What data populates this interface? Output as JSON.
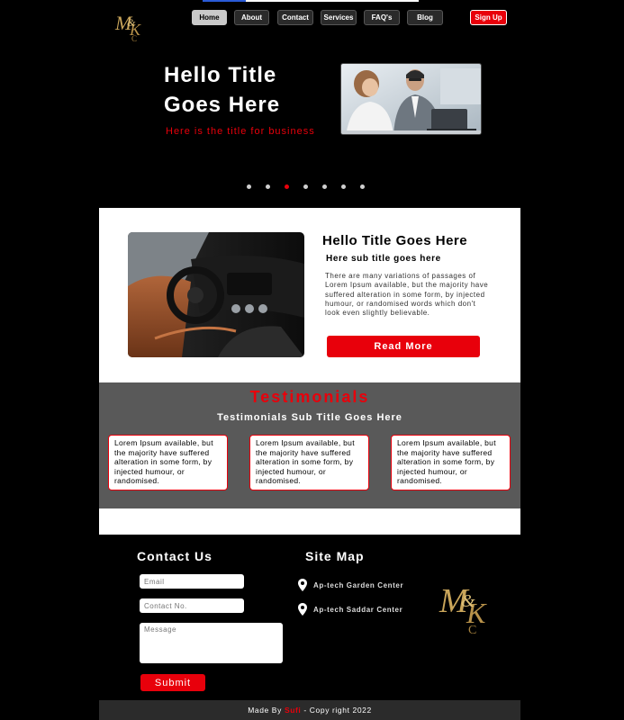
{
  "brand": {
    "logo_text": "M&K",
    "logo_color": "#c9a55a"
  },
  "nav": {
    "items": [
      "Home",
      "About",
      "Contact",
      "Services",
      "FAQ's",
      "Blog"
    ],
    "active": "Home",
    "signup": "Sign Up"
  },
  "hero": {
    "title": "Hello Title Goes Here",
    "subtitle": "Here is the title for business",
    "slides_total": 7,
    "active_slide": 3
  },
  "feature": {
    "title": "Hello Title Goes Here",
    "subtitle": "Here sub title goes here",
    "body": "There are many variations of passages of Lorem Ipsum available, but the majority have suffered alteration in some form, by injected humour, or randomised words which don't look even slightly believable.",
    "button": "Read More"
  },
  "testimonials": {
    "title": "Testimonials",
    "subtitle": "Testimonials Sub Title Goes Here",
    "cards": [
      "Lorem Ipsum available, but the majority have suffered alteration in some form, by injected humour, or randomised.",
      "Lorem Ipsum available, but the majority have suffered alteration in some form, by injected humour, or randomised.",
      "Lorem Ipsum available, but the majority have suffered alteration in some form, by injected humour, or randomised."
    ]
  },
  "contact": {
    "title": "Contact Us",
    "email_placeholder": "Email",
    "phone_placeholder": "Contact No.",
    "message_placeholder": "Message",
    "submit": "Submit"
  },
  "sitemap": {
    "title": "Site Map",
    "locations": [
      "Ap-tech Garden Center",
      "Ap-tech Saddar Center"
    ]
  },
  "footer": {
    "made_by": "Made By",
    "author": "Sufi",
    "copyright": "- Copy right 2022"
  },
  "colors": {
    "accent": "#e8000b",
    "dark_band": "#595959",
    "background": "#000000"
  }
}
